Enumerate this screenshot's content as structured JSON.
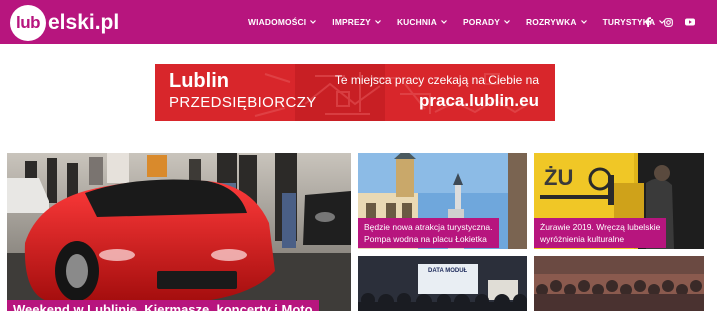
{
  "site": {
    "logo_circle": "lub",
    "logo_rest": "elski.pl",
    "brand_color": "#b7157e"
  },
  "nav": [
    {
      "label": "WIADOMOŚCI",
      "icon": "chevron-down-icon"
    },
    {
      "label": "IMPREZY",
      "icon": "chevron-down-icon"
    },
    {
      "label": "KUCHNIA",
      "icon": "chevron-down-icon"
    },
    {
      "label": "PORADY",
      "icon": "chevron-down-icon"
    },
    {
      "label": "ROZRYWKA",
      "icon": "chevron-down-icon"
    },
    {
      "label": "TURYSTYKA",
      "icon": "chevron-down-icon"
    }
  ],
  "social": [
    "facebook-icon",
    "instagram-icon",
    "youtube-icon"
  ],
  "banner": {
    "city": "Lublin",
    "sub": "PRZEDSIĘBIORCZY",
    "tag": "Te miejsca pracy czekają na Ciebie na",
    "url": "praca.lublin.eu",
    "bg_color": "#d8262b"
  },
  "articles": {
    "main": {
      "title": "Weekend w Lublinie. Kiermasze, koncerty i Moto"
    },
    "fountain": {
      "title_line1": "Będzie nowa atrakcja turystyczna.",
      "title_line2": "Pompa wodna na placu Łokietka"
    },
    "cranes": {
      "title_line1": "Żurawie 2019. Wręczą lubelskie",
      "title_line2": "wyróżnienia kulturalne"
    },
    "data_modul": {
      "screen_text": "DATA MODUŁ"
    },
    "crowd": {}
  }
}
